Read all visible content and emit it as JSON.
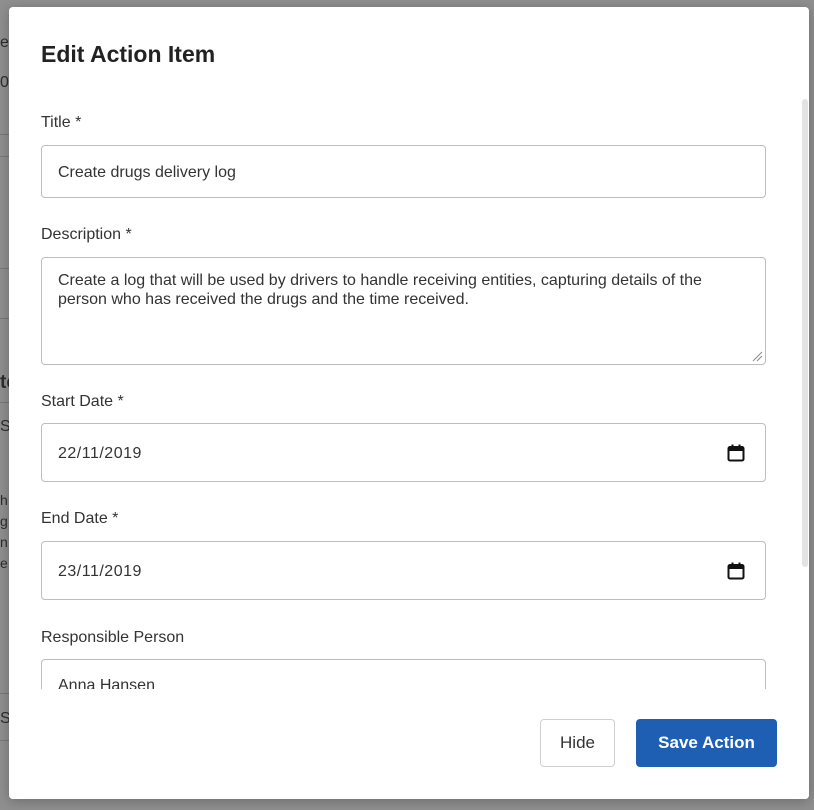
{
  "background": {
    "fragments": [
      "ec",
      "0",
      "tc",
      "S",
      "h",
      "g",
      "n",
      "e",
      "S"
    ]
  },
  "modal": {
    "title": "Edit Action Item",
    "fields": {
      "title": {
        "label": "Title *",
        "value": "Create drugs delivery log"
      },
      "description": {
        "label": "Description *",
        "value": "Create a log that will be used by drivers to handle receiving entities, capturing details of the person who has received the drugs and the time received."
      },
      "start_date": {
        "label": "Start Date *",
        "value": "22/11/2019"
      },
      "end_date": {
        "label": "End Date *",
        "value": "23/11/2019"
      },
      "responsible_person": {
        "label": "Responsible Person",
        "value": "Anna Hansen"
      }
    },
    "buttons": {
      "hide": "Hide",
      "save": "Save Action"
    }
  },
  "colors": {
    "primary": "#1f5fb3",
    "backdrop": "#8f8f8f",
    "border": "#bdbdbd"
  },
  "icons": {
    "date_picker": "calendar-icon"
  }
}
